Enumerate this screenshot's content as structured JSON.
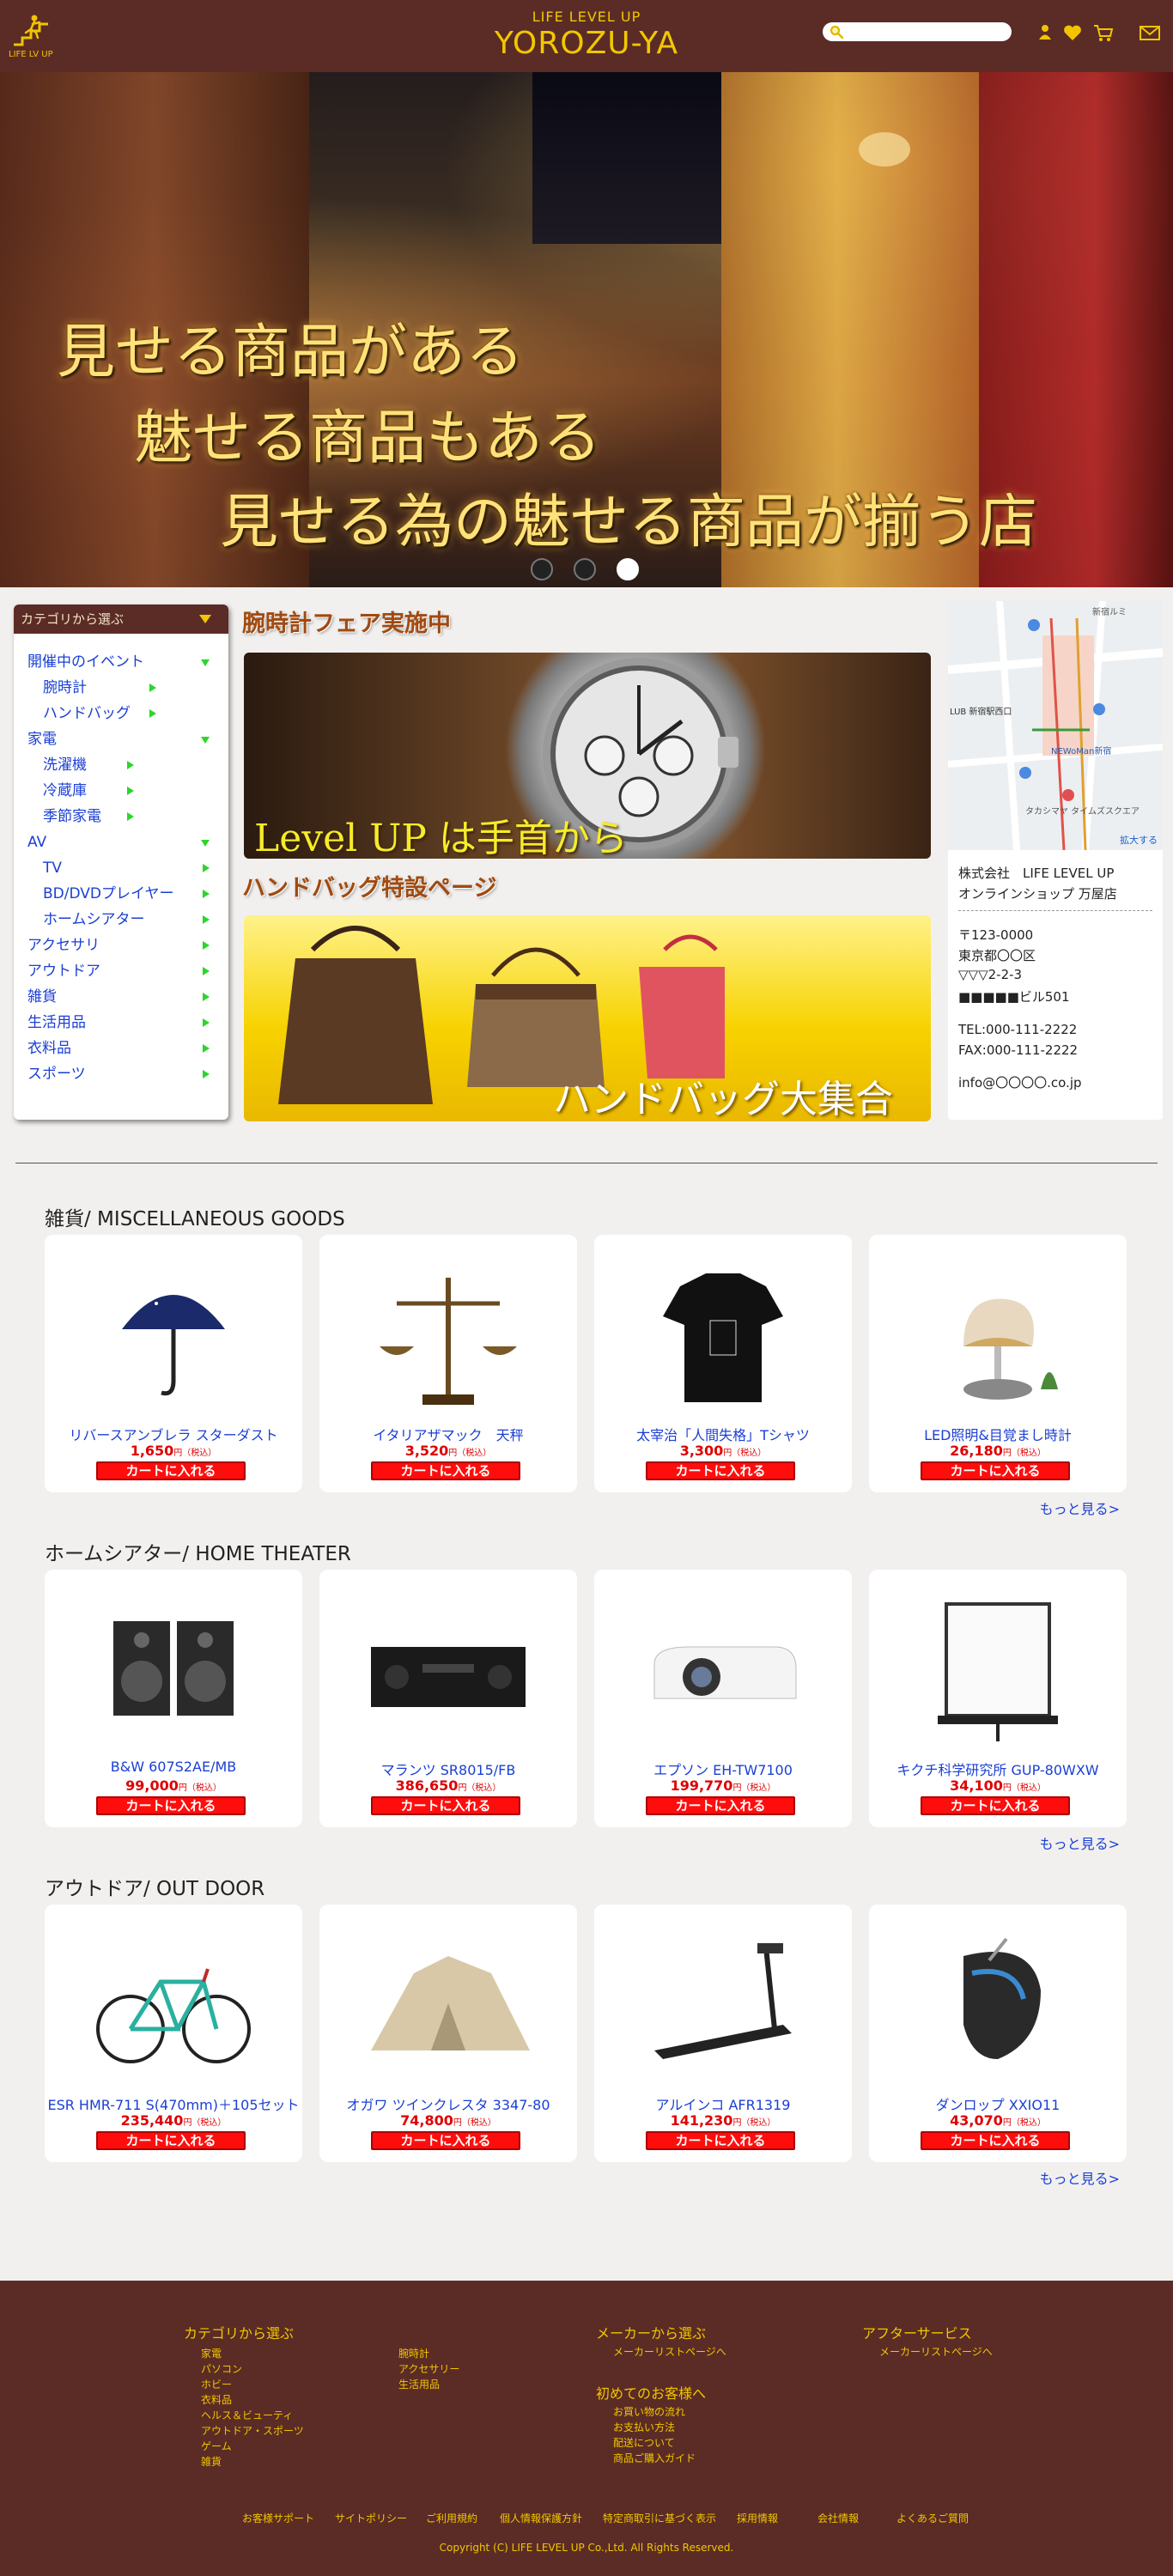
{
  "header": {
    "logo_text": "LIFE LV UP",
    "brand_sub": "LIFE LEVEL UP",
    "brand_main": "YOROZU-YA",
    "search_placeholder": ""
  },
  "icons": [
    "search-icon",
    "user-icon",
    "heart-icon",
    "cart-icon",
    "mail-icon"
  ],
  "hero": {
    "line1": "見せる商品がある",
    "line2": "魅せる商品もある",
    "line3": "見せる為の魅せる商品が揃う店",
    "slides": 3,
    "active_slide": 3
  },
  "categories": {
    "header": "カテゴリから選ぶ",
    "items": [
      {
        "label": "開催中のイベント",
        "level": 0,
        "arrow": "down"
      },
      {
        "label": "腕時計",
        "level": 1,
        "arrow": "right"
      },
      {
        "label": "ハンドバッグ",
        "level": 1,
        "arrow": "right"
      },
      {
        "label": "家電",
        "level": 0,
        "arrow": "down"
      },
      {
        "label": "洗濯機",
        "level": 1,
        "arrow": "right"
      },
      {
        "label": "冷蔵庫",
        "level": 1,
        "arrow": "right"
      },
      {
        "label": "季節家電",
        "level": 1,
        "arrow": "right"
      },
      {
        "label": "AV",
        "level": 0,
        "arrow": "down"
      },
      {
        "label": "TV",
        "level": 1,
        "arrow": "right"
      },
      {
        "label": "BD/DVDプレイヤー",
        "level": 1,
        "arrow": "right"
      },
      {
        "label": "ホームシアター",
        "level": 1,
        "arrow": "right"
      },
      {
        "label": "アクセサリ",
        "level": 0,
        "arrow": "right"
      },
      {
        "label": "アウトドア",
        "level": 0,
        "arrow": "right"
      },
      {
        "label": "雑貨",
        "level": 0,
        "arrow": "right"
      },
      {
        "label": "生活用品",
        "level": 0,
        "arrow": "right"
      },
      {
        "label": "衣料品",
        "level": 0,
        "arrow": "right"
      },
      {
        "label": "スポーツ",
        "level": 0,
        "arrow": "right"
      }
    ]
  },
  "promos": {
    "watch_title": "腕時計フェア実施中",
    "watch_caption": "Level UP は手首から",
    "bag_title": "ハンドバッグ特設ページ",
    "bag_caption": "ハンドバッグ大集合"
  },
  "shop_info": {
    "map_enlarge": "拡大する",
    "map_label_1": "新宿ルミ",
    "map_label_2": "LUB 新宿駅西口",
    "map_label_3": "NEWoMan新宿",
    "map_label_4": "タカシマヤ タイムズスクエア",
    "company": "株式会社　LIFE LEVEL UP",
    "shop_name": "オンラインショップ 万屋店",
    "postal": "〒123-0000",
    "addr1": "東京都〇〇区",
    "addr2": "▽▽▽2-2-3",
    "addr3": "■■■■■ビル501",
    "tel": "TEL:000-111-2222",
    "fax": "FAX:000-111-2222",
    "email": "info@〇〇〇〇.co.jp"
  },
  "sections": [
    {
      "title": "雑貨/ MISCELLANEOUS GOODS",
      "more": "もっと見る>",
      "products": [
        {
          "name": "リバースアンブレラ スターダスト",
          "price": "1,650",
          "icon": "umbrella-image"
        },
        {
          "name": "イタリアザマック　天秤",
          "price": "3,520",
          "icon": "scale-image"
        },
        {
          "name": "太宰治「人間失格」Tシャツ",
          "price": "3,300",
          "icon": "tshirt-image"
        },
        {
          "name": "LED照明&目覚まし時計",
          "price": "26,180",
          "icon": "bird-lamp-image"
        }
      ]
    },
    {
      "title": "ホームシアター/ HOME THEATER",
      "more": "もっと見る>",
      "products": [
        {
          "name": "B&W 607S2AE/MB",
          "price": "99,000",
          "icon": "speakers-image"
        },
        {
          "name": "マランツ SR8015/FB",
          "price": "386,650",
          "icon": "av-receiver-image"
        },
        {
          "name": "エプソン EH-TW7100",
          "price": "199,770",
          "icon": "projector-image"
        },
        {
          "name": "キクチ科学研究所 GUP-80WXW",
          "price": "34,100",
          "icon": "screen-image"
        }
      ]
    },
    {
      "title": "アウトドア/ OUT DOOR",
      "more": "もっと見る>",
      "products": [
        {
          "name": "ESR HMR-711 S(470mm)＋105セット",
          "price": "235,440",
          "icon": "bicycle-image"
        },
        {
          "name": "オガワ ツインクレスタ 3347-80",
          "price": "74,800",
          "icon": "tent-image"
        },
        {
          "name": "アルインコ AFR1319",
          "price": "141,230",
          "icon": "treadmill-image"
        },
        {
          "name": "ダンロップ XXIO11",
          "price": "43,070",
          "icon": "golf-driver-image"
        }
      ]
    }
  ],
  "cart_label": "カートに入れる",
  "yen_label": "円（税込）",
  "footer": {
    "cat_head": "カテゴリから選ぶ",
    "cat_col1": [
      "家電",
      "パソコン",
      "ホビー",
      "衣料品",
      "ヘルス＆ビューティ",
      "アウトドア・スポーツ",
      "ゲーム",
      "雑貨"
    ],
    "cat_col2": [
      "腕時計",
      "アクセサリー",
      "生活用品"
    ],
    "maker_head": "メーカーから選ぶ",
    "maker_link": "メーカーリストページへ",
    "first_head": "初めてのお客様へ",
    "first_links": [
      "お買い物の流れ",
      "お支払い方法",
      "配送について",
      "商品ご購入ガイド"
    ],
    "after_head": "アフターサービス",
    "after_link": "メーカーリストページへ",
    "bottom_links": [
      "お客様サポート",
      "サイトポリシー",
      "ご利用規約",
      "個人情報保護方針",
      "特定商取引に基づく表示",
      "採用情報",
      "会社情報",
      "よくあるご質問"
    ],
    "copyright": "Copyright (C) LIFE LEVEL UP Co.,Ltd. All Rights Reserved."
  },
  "colors": {
    "header_bg": "#5b2c25",
    "brand_gold": "#f0c800",
    "link_blue": "#1a3fd4",
    "price_red": "#e00000",
    "button_red": "#ff0d0d",
    "arrow_green": "#2bd62b"
  }
}
